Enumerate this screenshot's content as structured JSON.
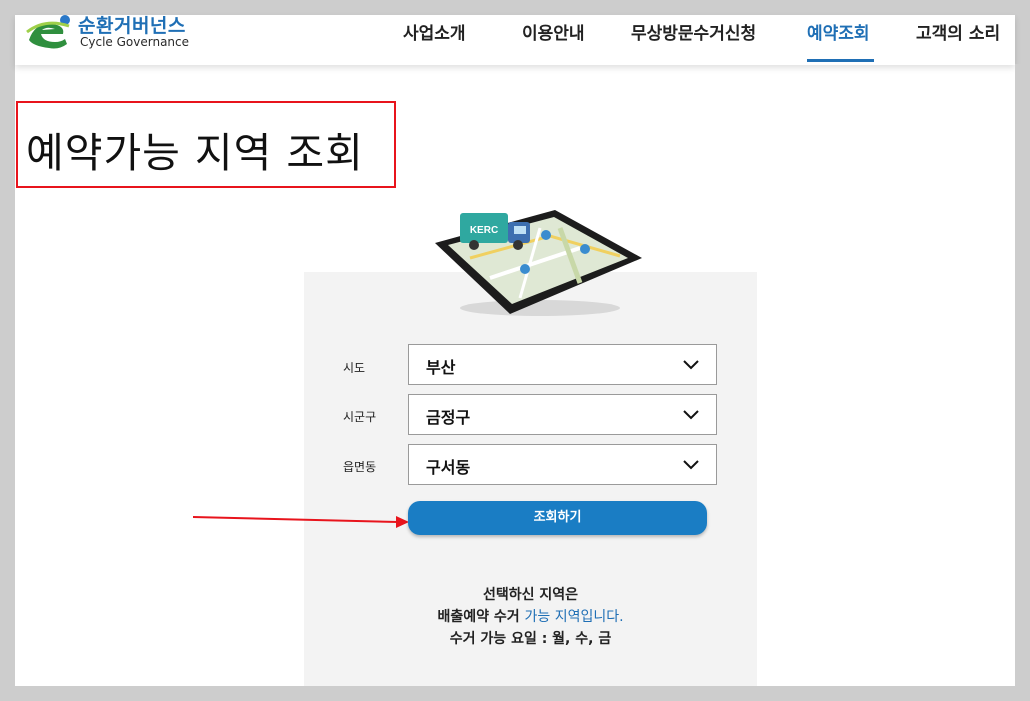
{
  "header": {
    "logo_ko": "순환거버넌스",
    "logo_en": "Cycle Governance",
    "nav": [
      "사업소개",
      "이용안내",
      "무상방문수거신청",
      "예약조회",
      "고객의 소리"
    ],
    "active_nav": "예약조회"
  },
  "page_title": "예약가능 지역 조회",
  "illustration": {
    "truck_label": "KERC"
  },
  "form": {
    "fields": [
      {
        "label": "시도",
        "value": "부산"
      },
      {
        "label": "시군구",
        "value": "금정구"
      },
      {
        "label": "읍면동",
        "value": "구서동"
      }
    ],
    "submit_label": "조회하기"
  },
  "result": {
    "line1": "선택하신 지역은",
    "line2_prefix": "배출예약 수거 ",
    "line2_highlight": "가능 지역입니다.",
    "line3": "수거 가능 요일 : 월, 수, 금"
  },
  "colors": {
    "accent": "#1f6fb5",
    "button": "#1a7dc4",
    "annotation_red": "#e8141c"
  }
}
